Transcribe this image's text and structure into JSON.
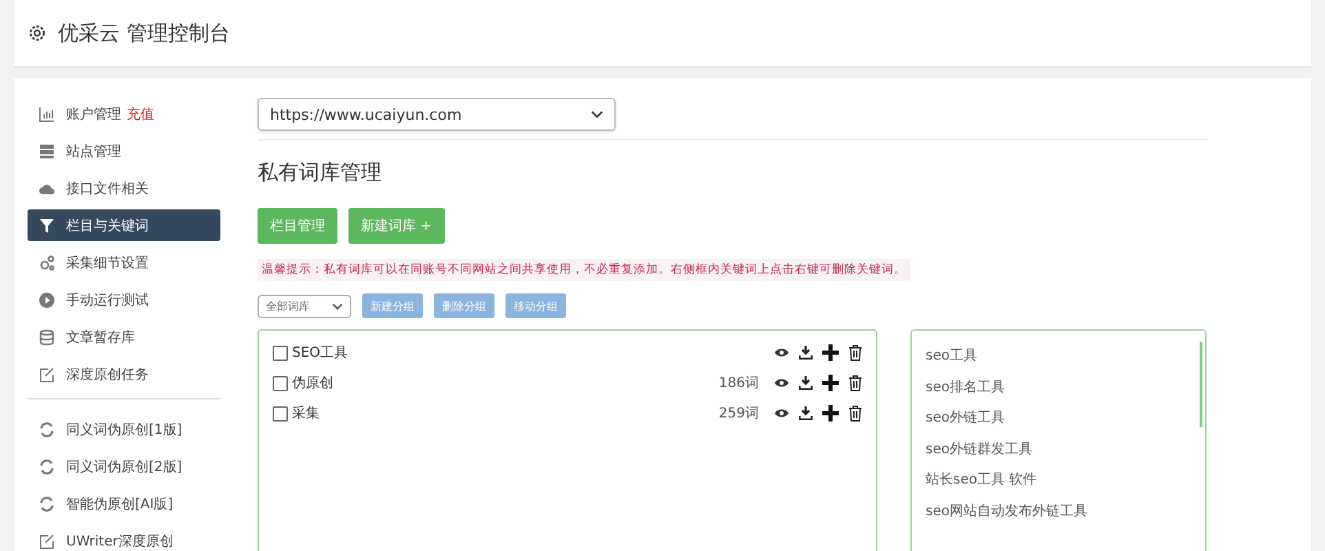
{
  "header": {
    "title": "优采云 管理控制台"
  },
  "sidebar": {
    "items": [
      {
        "label": "账户管理",
        "badge": "充值",
        "kind": "chart",
        "selected": false
      },
      {
        "label": "站点管理",
        "kind": "server",
        "selected": false
      },
      {
        "label": "接口文件相关",
        "kind": "cloud",
        "selected": false
      },
      {
        "label": "栏目与关键词",
        "kind": "filter",
        "selected": true
      },
      {
        "label": "采集细节设置",
        "kind": "gears",
        "selected": false
      },
      {
        "label": "手动运行测试",
        "kind": "play",
        "selected": false
      },
      {
        "label": "文章暂存库",
        "kind": "db",
        "selected": false
      },
      {
        "label": "深度原创任务",
        "kind": "edit",
        "selected": false
      }
    ],
    "items2": [
      {
        "label": "同义词伪原创[1版]",
        "kind": "refresh",
        "selected": false
      },
      {
        "label": "同义词伪原创[2版]",
        "kind": "refresh",
        "selected": false
      },
      {
        "label": "智能伪原创[AI版]",
        "kind": "refresh",
        "selected": false
      },
      {
        "label": "UWriter深度原创",
        "kind": "edit",
        "selected": false
      }
    ]
  },
  "site_select": {
    "value": "https://www.ucaiyun.com"
  },
  "heading": "私有词库管理",
  "buttons": [
    {
      "label": "栏目管理"
    },
    {
      "label": "新建词库 +"
    }
  ],
  "tip": "温馨提示：私有词库可以在同账号不同网站之间共享使用，不必重复添加。右侧框内关键词上点击右键可删除关键词。",
  "filter_select": {
    "value": "全部词库"
  },
  "group_buttons": [
    {
      "label": "新建分组"
    },
    {
      "label": "删除分组"
    },
    {
      "label": "移动分组"
    }
  ],
  "groups": [
    {
      "name": "SEO工具",
      "checked": false
    },
    {
      "name": "伪原创",
      "count": "186词",
      "checked": false
    },
    {
      "name": "采集",
      "count": "259词",
      "checked": false
    }
  ],
  "keywords": [
    "seo工具",
    "seo排名工具",
    "seo外链工具",
    "seo外链群发工具",
    "站长seo工具 软件",
    "seo网站自动发布外链工具"
  ]
}
